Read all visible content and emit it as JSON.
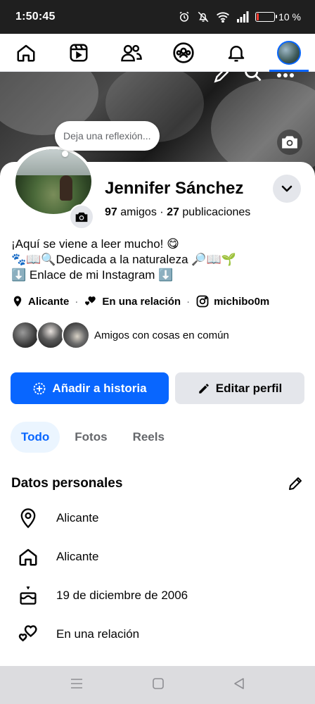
{
  "status_bar": {
    "time": "1:50:45",
    "battery_percent": "10 %",
    "battery_level": 0.1
  },
  "navbar": {
    "items": [
      {
        "name": "home-icon"
      },
      {
        "name": "video-icon"
      },
      {
        "name": "friends-icon"
      },
      {
        "name": "groups-icon"
      },
      {
        "name": "notifications-icon"
      },
      {
        "name": "profile-avatar",
        "active": true
      }
    ]
  },
  "reflection": {
    "placeholder": "Deja una reflexión..."
  },
  "profile": {
    "name": "Jennifer Sánchez",
    "friends_count": "97",
    "friends_label": "amigos",
    "separator": "·",
    "posts_count": "27",
    "posts_label": "publicaciones"
  },
  "bio": {
    "line1": "¡Aquí se viene a leer mucho! 😋",
    "line2": "🐾📖🔍Dedicada a la naturaleza 🔎📖🌱",
    "line3": "⬇️ Enlace de mi Instagram ⬇️"
  },
  "meta": {
    "location": "Alicante",
    "relationship": "En una relación",
    "instagram": "michibo0m",
    "separator": "·"
  },
  "mutual": {
    "label": "Amigos con cosas en común"
  },
  "actions": {
    "add_story": "Añadir a historia",
    "edit_profile": "Editar perfil"
  },
  "tabs": [
    {
      "label": "Todo",
      "active": true
    },
    {
      "label": "Fotos",
      "active": false
    },
    {
      "label": "Reels",
      "active": false
    }
  ],
  "personal": {
    "title": "Datos personales",
    "items": [
      {
        "icon": "location-pin-icon",
        "text": "Alicante"
      },
      {
        "icon": "home-icon",
        "text": "Alicante"
      },
      {
        "icon": "birthday-cake-icon",
        "text": "19 de diciembre de 2006"
      },
      {
        "icon": "hearts-icon",
        "text": "En una relación"
      }
    ]
  },
  "colors": {
    "accent": "#0866ff",
    "secondary_button": "#e4e6eb",
    "status_bar": "#1f1f1f",
    "battery_low": "#ff3b30"
  }
}
